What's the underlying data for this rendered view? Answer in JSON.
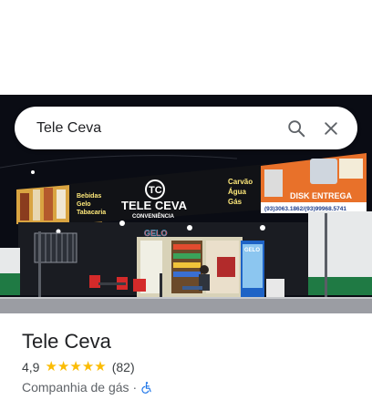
{
  "search": {
    "query": "Tele Ceva"
  },
  "photo": {
    "sign_left": [
      "Bebidas",
      "Gelo",
      "Tabacaria"
    ],
    "brand_main": "TELE CEVA",
    "brand_sub": "CONVENIÊNCIA",
    "brand_logo": "TC",
    "sign_right": [
      "Carvão",
      "Água",
      "Gás"
    ],
    "promo_banner": "DISK ENTREGA",
    "phones": "(93)3063.1862/(93)99968.5741",
    "neon": "GELO",
    "cooler_label": "GELO"
  },
  "place": {
    "name": "Tele Ceva",
    "rating": "4,9",
    "review_count": "(82)",
    "stars": 5,
    "category": "Companhia de gás",
    "separator": "·"
  },
  "colors": {
    "star": "#fbbc04",
    "accessibility": "#1a73e8"
  }
}
